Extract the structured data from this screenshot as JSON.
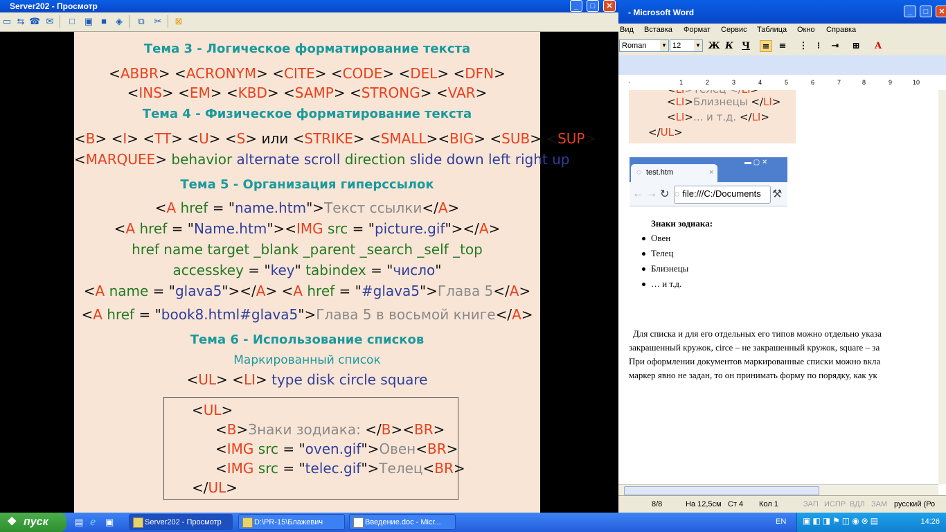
{
  "viewer": {
    "title": "Server202 - Просмотр",
    "slide": {
      "topic3": "Тема 3 - Логическое форматирование текста",
      "topic4": "Тема 4 - Физическое форматирование текста",
      "topic5": "Тема 5 - Организация гиперссылок",
      "topic6": "Тема 6 - Использование списков",
      "marked_list": "Маркированный список",
      "link_text": "Текст ссылки",
      "chapter5": "Глава 5",
      "chapter5_book": "Глава 5 в восьмой книге",
      "or_word": "или",
      "zodiac": "Знаки зодиака: ",
      "oven": "Овен",
      "telec": "Телец",
      "number_word": "число"
    }
  },
  "word": {
    "title": "- Microsoft Word",
    "menu": [
      "Вид",
      "Вставка",
      "Формат",
      "Сервис",
      "Таблица",
      "Окно",
      "Справка"
    ],
    "font_name": "Roman",
    "font_size": "12",
    "card": {
      "line1": ">Телец </",
      "line2_text": "Близнецы ",
      "line3_text": "... и т.д. "
    },
    "browser": {
      "tab_title": "test.htm",
      "url": "file:///C:/Documents",
      "heading": "Знаки зодиака:",
      "items": [
        "Овен",
        "Телец",
        "Близнецы",
        "… и т.д."
      ]
    },
    "paragraph": [
      "Для списка и для его отдельных его типов можно отдельно указа",
      "закрашенный кружок, circe – не закрашенный кружок, square – за",
      "При оформлении документов маркированные списки можно вкла",
      "маркер явно не задан, то он принимать форму по порядку, как ук"
    ],
    "status": {
      "pages": "8/8",
      "position": "На 12,5см",
      "line": "Ст 4",
      "col": "Кол 1",
      "zap": "ЗАП",
      "ispr": "ИСПР",
      "vdl": "ВДЛ",
      "zam": "ЗАМ",
      "lang": "русский (Ро"
    }
  },
  "taskbar": {
    "start": "пуск",
    "buttons": [
      "Server202 - Просмотр",
      "D:\\PR-15\\Блажевич",
      "Введение.doc - Micr..."
    ],
    "lang": "EN",
    "clock": "14:26"
  }
}
